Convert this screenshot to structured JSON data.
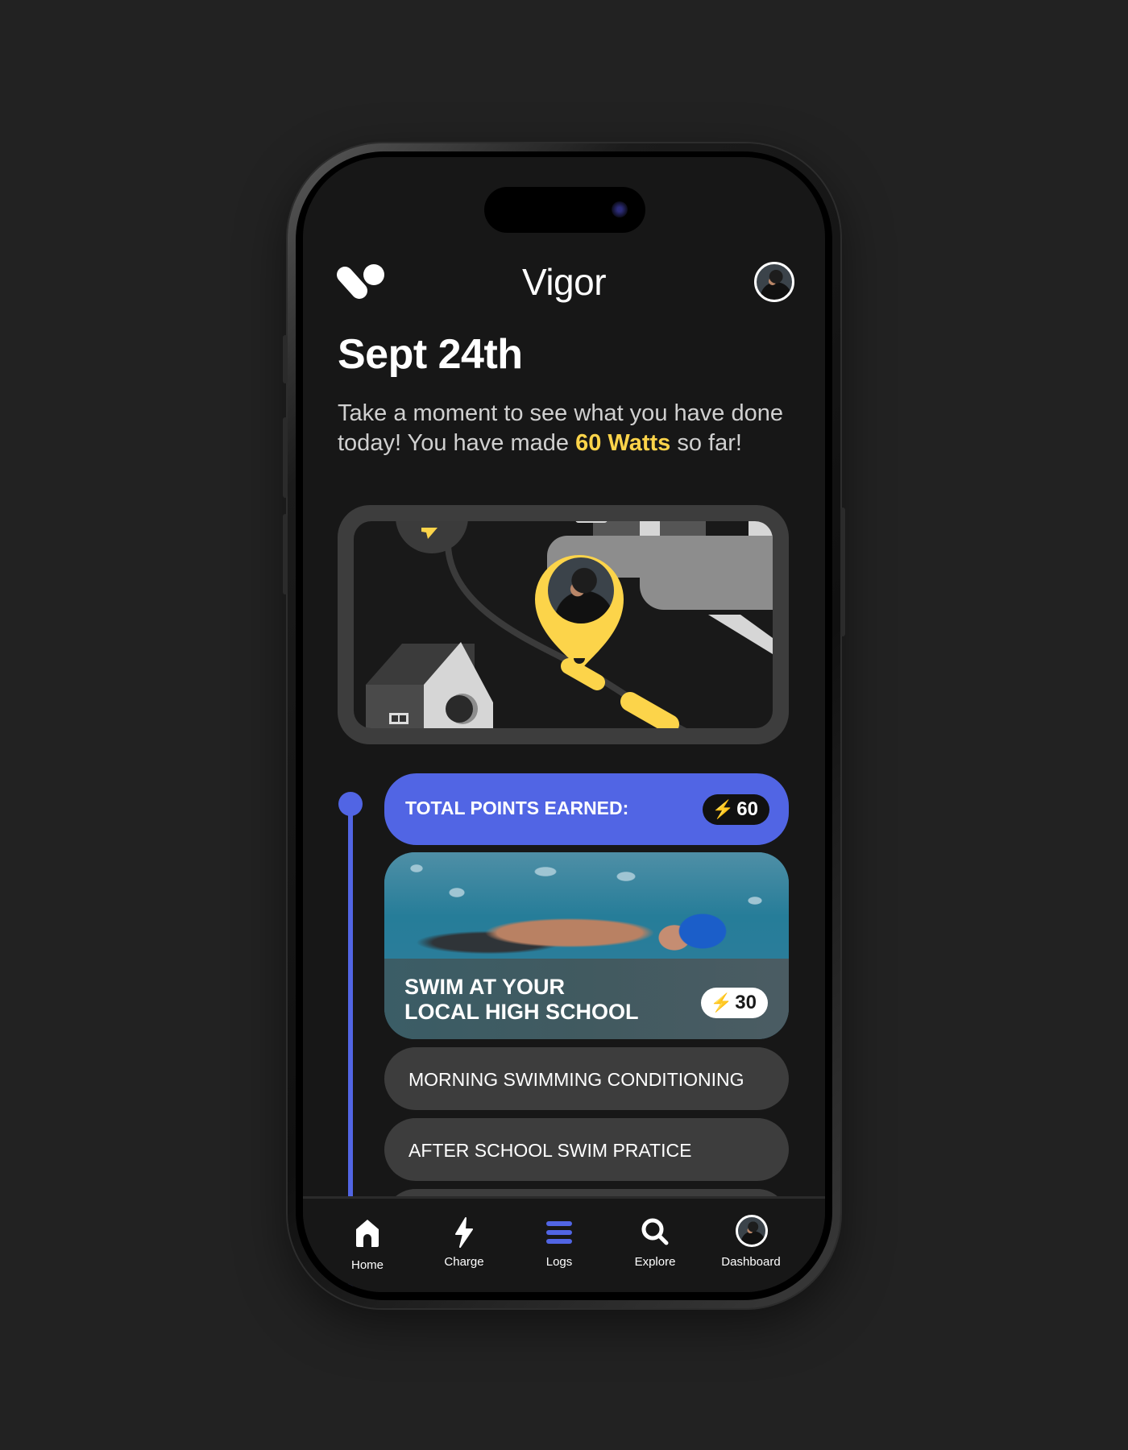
{
  "app": {
    "title": "Vigor",
    "logo_icon": "vigor-logo-icon",
    "profile_icon": "user-avatar"
  },
  "summary": {
    "date": "Sept 24th",
    "intro_before": "Take a moment to see what you have done today! You have made ",
    "intro_highlight": "60 Watts",
    "intro_after": " so far!"
  },
  "map": {
    "description": "Activity route map with user location pin",
    "pin_icon": "location-pin-avatar",
    "start_icon": "lightning-icon"
  },
  "points": {
    "label": "TOTAL POINTS EARNED:",
    "value": "60",
    "icon": "lightning-icon"
  },
  "featured_activity": {
    "title_line1": "SWIM AT YOUR",
    "title_line2": "LOCAL HIGH SCHOOL",
    "points": "30",
    "icon": "lightning-icon"
  },
  "logs": [
    {
      "label": "MORNING SWIMMING CONDITIONING"
    },
    {
      "label": "AFTER SCHOOL SWIM PRATICE"
    },
    {
      "label": ""
    }
  ],
  "nav": {
    "active": "Logs",
    "accent": "#5165e4",
    "items": [
      {
        "label": "Home",
        "icon": "home-icon"
      },
      {
        "label": "Charge",
        "icon": "lightning-icon"
      },
      {
        "label": "Logs",
        "icon": "list-icon"
      },
      {
        "label": "Explore",
        "icon": "search-icon"
      },
      {
        "label": "Dashboard",
        "icon": "avatar"
      }
    ]
  },
  "colors": {
    "accent_blue": "#5165e4",
    "accent_yellow": "#fcd44a",
    "background": "#171717",
    "card": "#3d3d3d"
  }
}
